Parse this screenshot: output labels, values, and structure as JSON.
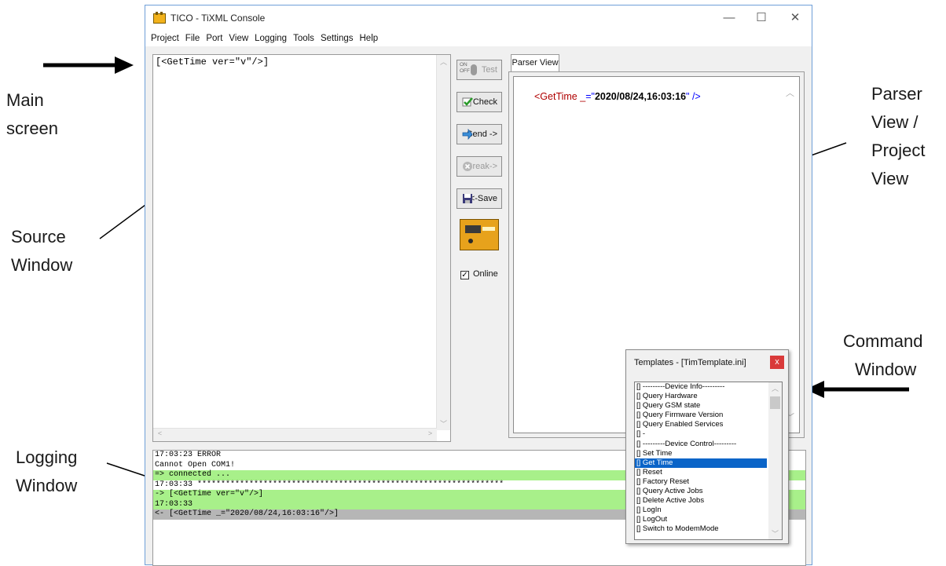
{
  "annotations": {
    "main_screen": [
      "Main",
      "screen"
    ],
    "source_window": [
      "Source",
      "Window"
    ],
    "logging_window": [
      "Logging",
      "Window"
    ],
    "parser_view": [
      "Parser",
      "View /",
      "Project",
      "View"
    ],
    "command_window": [
      "Command",
      "Window"
    ]
  },
  "window": {
    "title": "TICO - TiXML Console",
    "controls": {
      "minimize": "—",
      "maximize": "☐",
      "close": "✕"
    }
  },
  "menu": [
    "Project",
    "File",
    "Port",
    "View",
    "Logging",
    "Tools",
    "Settings",
    "Help"
  ],
  "source": {
    "text": "[<GetTime ver=\"v\"/>]"
  },
  "buttons": {
    "test": "Test",
    "test_on": "ON",
    "test_off": "OFF",
    "check": "Check",
    "send": "Send ->",
    "break": "Break->",
    "save": "<-Save"
  },
  "online": {
    "label": "Online",
    "checked": true,
    "mark": "✓"
  },
  "parser": {
    "tab": "Parser View",
    "tag": "<GetTime",
    "attr": "_",
    "eq": "=\"",
    "value": "2020/08/24,16:03:16",
    "close": "\" />"
  },
  "log": [
    {
      "text": "17:03:23 ERROR",
      "style": "plain"
    },
    {
      "text": "Cannot Open COM1!",
      "style": "plain"
    },
    {
      "text": "=> connected ...",
      "style": "green"
    },
    {
      "text": "17:03:33 *****************************************************************",
      "style": "plain"
    },
    {
      "text": "-> [<GetTime ver=\"v\"/>]",
      "style": "green"
    },
    {
      "text": "17:03:33",
      "style": "green"
    },
    {
      "text": "<- [<GetTime _=\"2020/08/24,16:03:16\"/>]",
      "style": "gray"
    }
  ],
  "templates": {
    "title": "Templates - [TimTemplate.ini]",
    "close": "x",
    "items": [
      "[] ---------Device Info---------",
      "[] Query Hardware",
      "[] Query GSM state",
      "[] Query Firmware Version",
      "[] Query Enabled Services",
      "[] -",
      "[] ---------Device Control---------",
      "[] Set Time",
      "[] Get Time",
      "[] Reset",
      "[] Factory Reset",
      "[] Query Active Jobs",
      "[] Delete Active Jobs",
      "[] LogIn",
      "[] LogOut",
      "[] Switch to ModemMode"
    ],
    "selected_index": 8
  },
  "colors": {
    "log_green": "#a8f08a",
    "log_gray": "#b6b6b6",
    "selection": "#0a64c8",
    "close_red": "#d93a3a"
  }
}
